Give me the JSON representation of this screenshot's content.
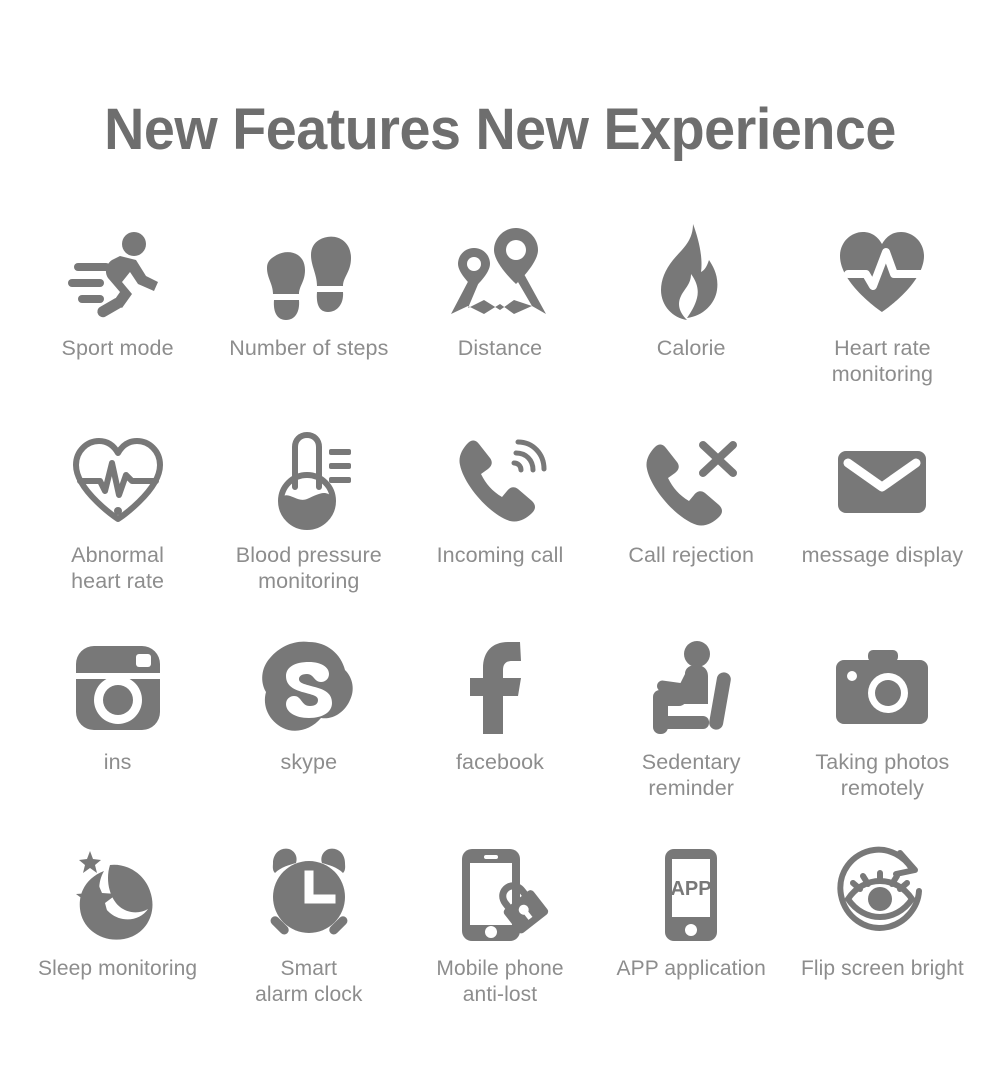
{
  "page": {
    "background_color": "#ffffff",
    "icon_color": "#787878",
    "label_color": "#8d8d8d",
    "title_color": "#6e6e6e"
  },
  "header": {
    "title": "New Features New Experience"
  },
  "features": {
    "rows": [
      [
        {
          "icon": "running-person-icon",
          "label": "Sport mode"
        },
        {
          "icon": "footprints-icon",
          "label": "Number of steps"
        },
        {
          "icon": "map-pin-route-icon",
          "label": "Distance"
        },
        {
          "icon": "flame-icon",
          "label": "Calorie"
        },
        {
          "icon": "heart-pulse-filled-icon",
          "label": "Heart rate\nmonitoring"
        }
      ],
      [
        {
          "icon": "heart-ecg-outline-icon",
          "label": "Abnormal\nheart rate"
        },
        {
          "icon": "thermometer-icon",
          "label": "Blood pressure\nmonitoring"
        },
        {
          "icon": "phone-ringing-icon",
          "label": "Incoming call"
        },
        {
          "icon": "phone-reject-icon",
          "label": "Call rejection"
        },
        {
          "icon": "envelope-icon",
          "label": "message display"
        }
      ],
      [
        {
          "icon": "instagram-icon",
          "label": "ins"
        },
        {
          "icon": "skype-icon",
          "label": "skype"
        },
        {
          "icon": "facebook-icon",
          "label": "facebook"
        },
        {
          "icon": "seated-person-icon",
          "label": "Sedentary\nreminder"
        },
        {
          "icon": "camera-icon",
          "label": "Taking photos\nremotely"
        }
      ],
      [
        {
          "icon": "moon-stars-icon",
          "label": "Sleep monitoring"
        },
        {
          "icon": "alarm-clock-icon",
          "label": "Smart\nalarm clock"
        },
        {
          "icon": "phone-lock-icon",
          "label": "Mobile phone\nanti-lost"
        },
        {
          "icon": "phone-app-icon",
          "label": "APP application"
        },
        {
          "icon": "eye-rotate-icon",
          "label": "Flip screen bright"
        }
      ]
    ]
  },
  "icon_text": {
    "app_label": "APP"
  }
}
